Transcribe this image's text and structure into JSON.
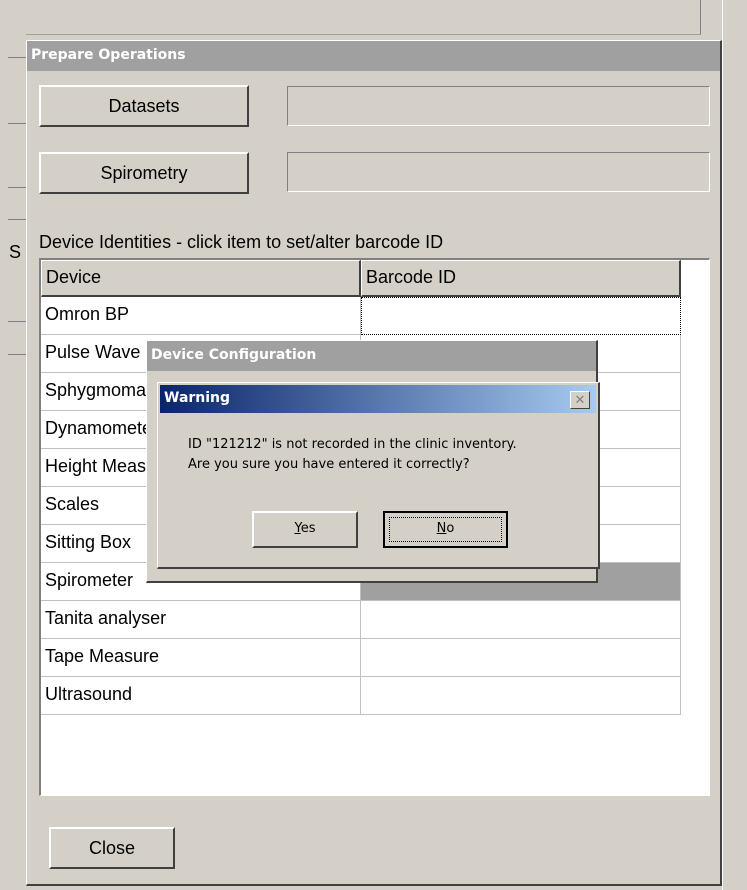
{
  "window": {
    "title": "Prepare Operations"
  },
  "buttons": {
    "datasets": "Datasets",
    "spirometry": "Spirometry",
    "close": "Close"
  },
  "device_list": {
    "caption": "Device Identities - click item to set/alter barcode ID",
    "columns": [
      "Device",
      "Barcode ID"
    ],
    "rows": [
      {
        "device": "Omron BP",
        "barcode": ""
      },
      {
        "device": "Pulse Wave",
        "barcode": ""
      },
      {
        "device": "Sphygmomanometer",
        "barcode": ""
      },
      {
        "device": "Dynamometer",
        "barcode": ""
      },
      {
        "device": "Height Measure",
        "barcode": ""
      },
      {
        "device": "Scales",
        "barcode": ""
      },
      {
        "device": "Sitting Box",
        "barcode": ""
      },
      {
        "device": "Spirometer",
        "barcode": ""
      },
      {
        "device": "Tanita analyser",
        "barcode": ""
      },
      {
        "device": "Tape Measure",
        "barcode": ""
      },
      {
        "device": "Ultrasound",
        "barcode": ""
      }
    ]
  },
  "device_config_dialog": {
    "title": "Device Configuration"
  },
  "warning_dialog": {
    "title": "Warning",
    "message_line1": "ID \"121212\" is not recorded in the clinic inventory.",
    "message_line2": "Are you sure you have entered it correctly?",
    "yes_mnemonic": "Y",
    "yes_rest": "es",
    "no_mnemonic": "N",
    "no_rest": "o",
    "close_glyph": "✕"
  },
  "background": {
    "letter": "S"
  }
}
